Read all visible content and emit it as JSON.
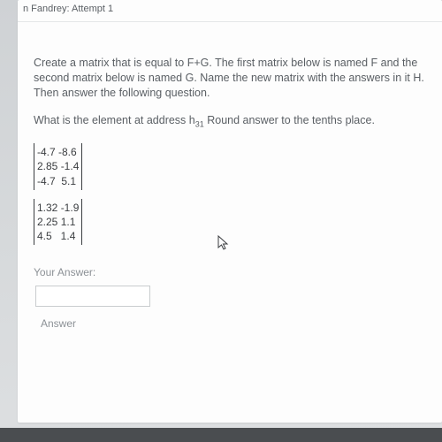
{
  "header": {
    "title": "n Fandrey: Attempt 1"
  },
  "question": {
    "intro": "Create a matrix that is equal to F+G. The first matrix below is named F and the second matrix below is named G. Name the new matrix with the answers in it H. Then answer the following question.",
    "prompt_pre": "What is the element at address h",
    "prompt_sub": "31",
    "prompt_post": " Round answer to the tenths place."
  },
  "matrixF": {
    "r1": "-4.7 -8.6",
    "r2": "2.85 -1.4",
    "r3": "-4.7  5.1"
  },
  "matrixG": {
    "r1": "1.32 -1.9",
    "r2": "2.25 1.1",
    "r3": "4.5   1.4"
  },
  "answer": {
    "label": "Your Answer:",
    "value": "",
    "button": "Answer"
  },
  "cursor_glyph": "↖"
}
